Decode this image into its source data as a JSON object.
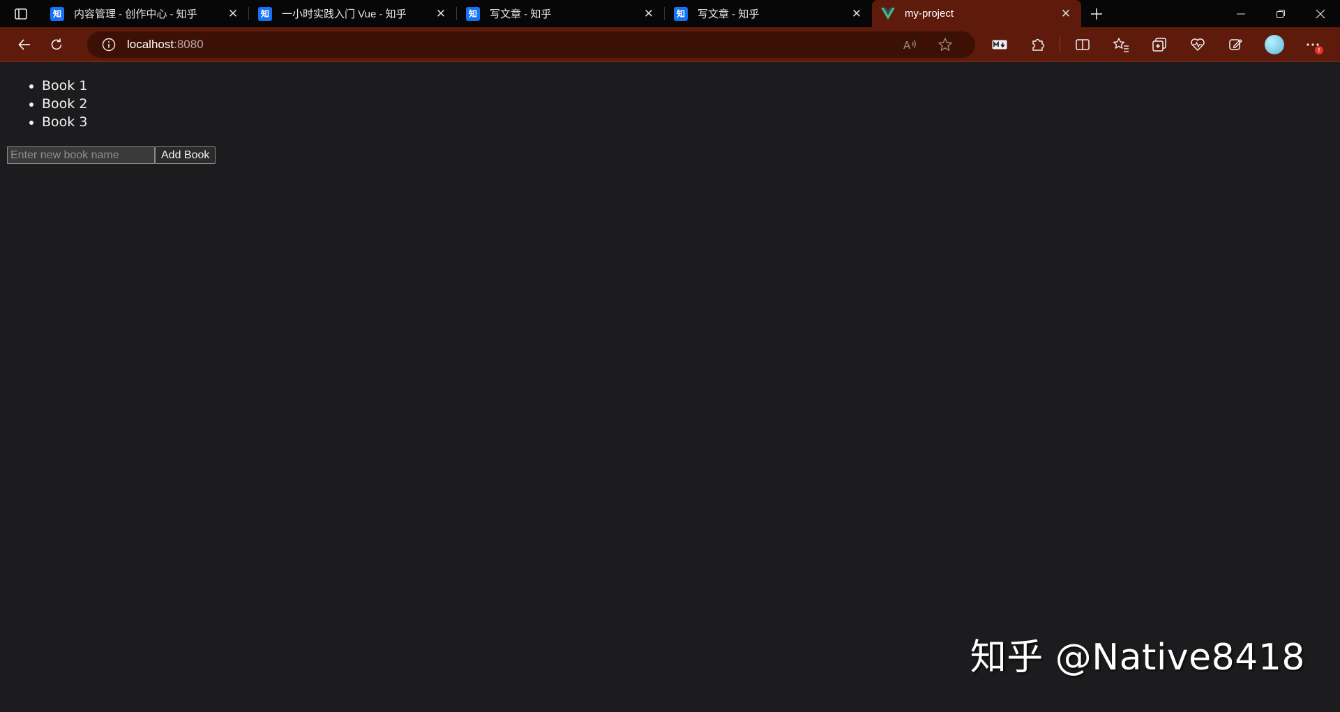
{
  "tabs": [
    {
      "title": "内容管理 - 创作中心 - 知乎",
      "favicon": "知",
      "close": "✕"
    },
    {
      "title": "一小时实践入门 Vue - 知乎",
      "favicon": "知",
      "close": "✕"
    },
    {
      "title": "写文章 - 知乎",
      "favicon": "知",
      "close": "✕"
    },
    {
      "title": "写文章 - 知乎",
      "favicon": "知",
      "close": "✕"
    },
    {
      "title": "my-project",
      "favicon": "vue-logo",
      "close": "✕",
      "active": true
    }
  ],
  "address": {
    "host": "localhost",
    "port": ":8080"
  },
  "page": {
    "books": [
      "Book 1",
      "Book 2",
      "Book 3"
    ],
    "input_placeholder": "Enter new book name",
    "add_button": "Add Book"
  },
  "watermark": "知乎 @Native8418",
  "badge": "!",
  "colors": {
    "accent": "#5e1a0b",
    "zhihu_blue": "#1772f6",
    "vue_green": "#41b883",
    "page_bg": "#1c1c1e"
  }
}
